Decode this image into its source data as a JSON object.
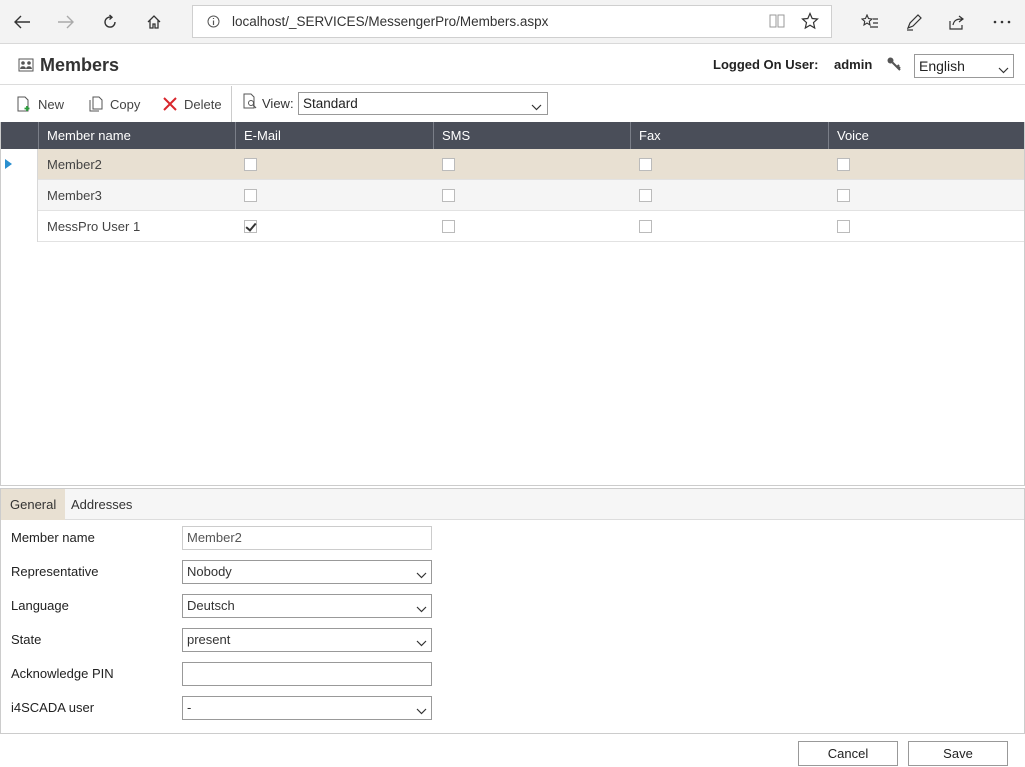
{
  "browser": {
    "url": "localhost/_SERVICES/MessengerPro/Members.aspx"
  },
  "header": {
    "title": "Members",
    "logged_label": "Logged On User:",
    "user": "admin",
    "language": "English"
  },
  "toolbar": {
    "new_label": "New",
    "copy_label": "Copy",
    "delete_label": "Delete",
    "view_label": "View:",
    "view_value": "Standard"
  },
  "grid": {
    "columns": [
      "Member name",
      "E-Mail",
      "SMS",
      "Fax",
      "Voice"
    ],
    "rows": [
      {
        "name": "Member2",
        "email": false,
        "sms": false,
        "fax": false,
        "voice": false
      },
      {
        "name": "Member3",
        "email": false,
        "sms": false,
        "fax": false,
        "voice": false
      },
      {
        "name": "MessPro User 1",
        "email": true,
        "sms": false,
        "fax": false,
        "voice": false
      }
    ]
  },
  "detail": {
    "tabs": [
      "General",
      "Addresses"
    ],
    "fields": {
      "member_name_label": "Member name",
      "member_name_value": "Member2",
      "representative_label": "Representative",
      "representative_value": "Nobody",
      "language_label": "Language",
      "language_value": "Deutsch",
      "state_label": "State",
      "state_value": "present",
      "ack_pin_label": "Acknowledge PIN",
      "ack_pin_value": "",
      "scada_label": "i4SCADA user",
      "scada_value": "-"
    }
  },
  "footer": {
    "cancel_label": "Cancel",
    "save_label": "Save"
  }
}
